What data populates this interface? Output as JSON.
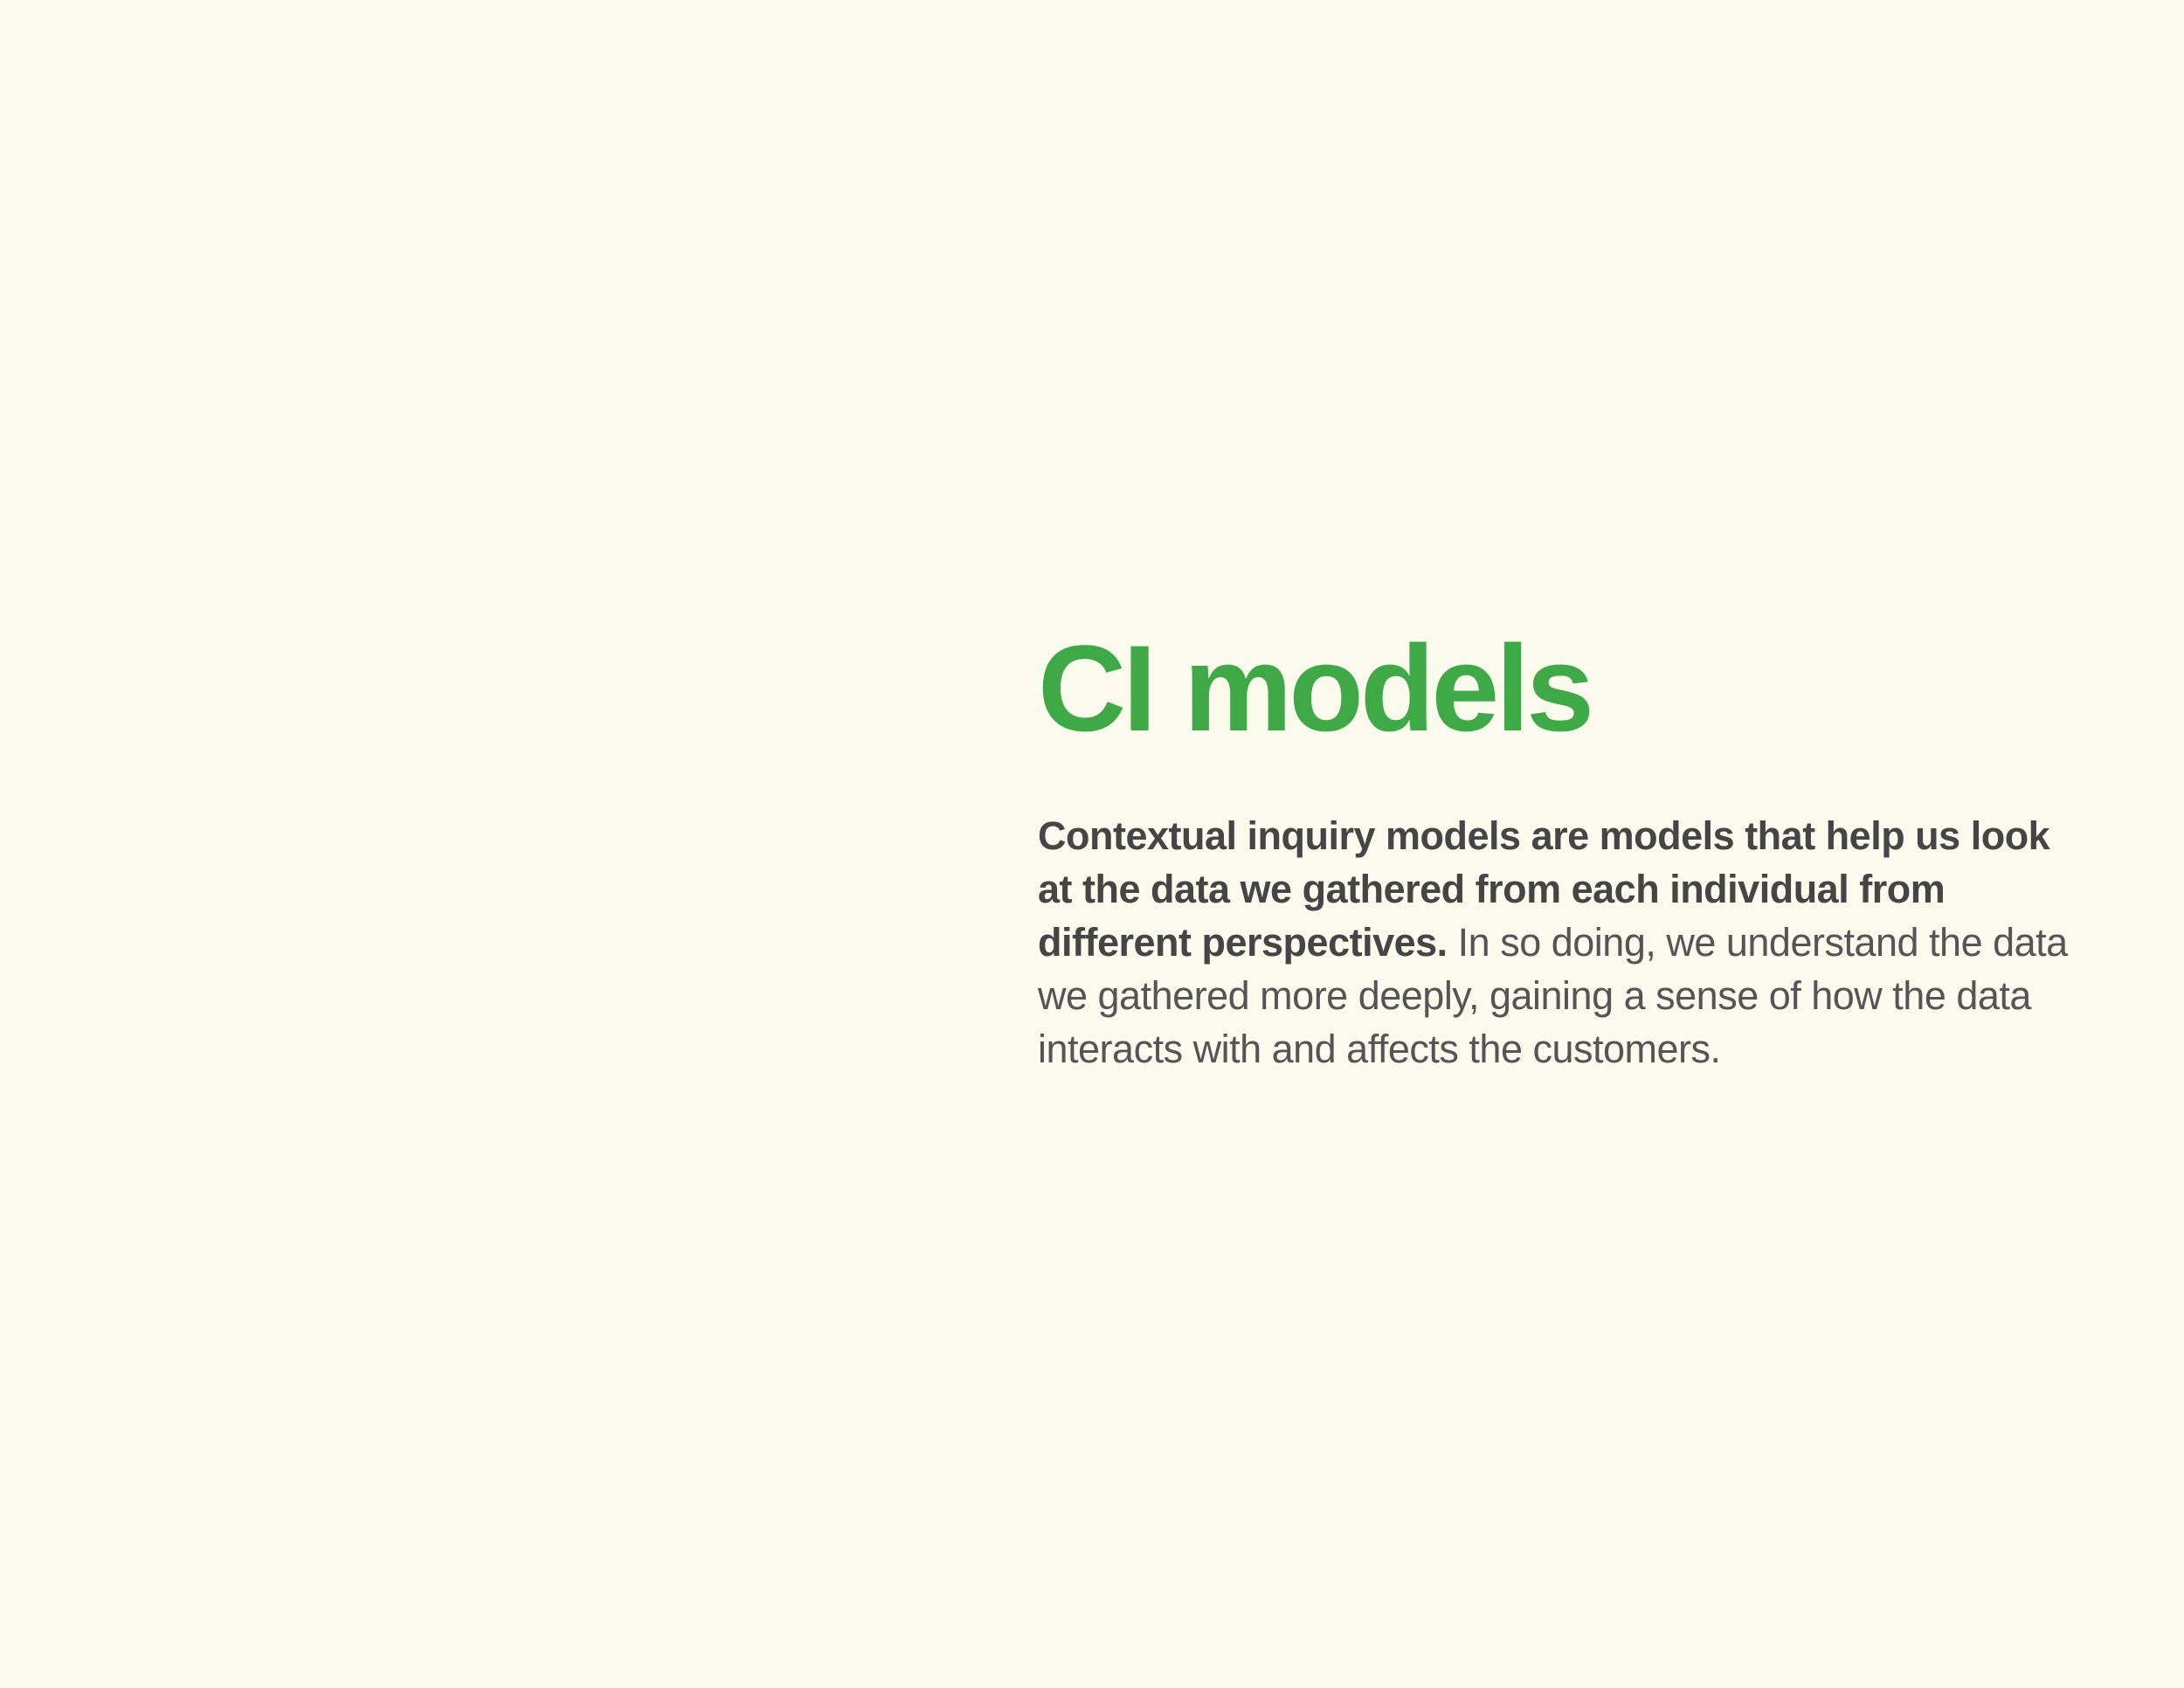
{
  "page": {
    "title": "CI models",
    "body_lead": "Contextual inquiry models are models that help us look at the data we gathered from each individual from different perspectives.",
    "body_rest": " In so doing, we understand the data we gathered more deeply, gaining a sense of how the data interacts with and affects the customers."
  },
  "colors": {
    "background": "#fafaed",
    "title": "#3fa847",
    "text": "#4a4a4a"
  }
}
